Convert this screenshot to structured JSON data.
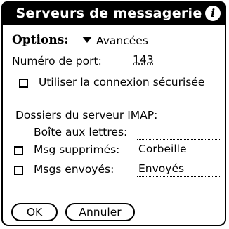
{
  "dialog": {
    "title": "Serveurs de messagerie",
    "info_icon": "info-icon",
    "info_glyph": "i"
  },
  "options": {
    "label": "Options:",
    "selected": "Avancées"
  },
  "port": {
    "label": "Numéro de port:",
    "value": "143"
  },
  "secure": {
    "label": "Utiliser la connexion sécurisée",
    "checked": false
  },
  "imap": {
    "heading": "Dossiers du serveur IMAP:",
    "inbox_label": "Boîte aux lettres:",
    "inbox_value": "",
    "deleted_label": "Msg supprimés:",
    "deleted_value": "Corbeille",
    "deleted_checked": false,
    "sent_label": "Msgs envoyés:",
    "sent_value": "Envoyés",
    "sent_checked": false
  },
  "buttons": {
    "ok": "OK",
    "cancel": "Annuler"
  }
}
